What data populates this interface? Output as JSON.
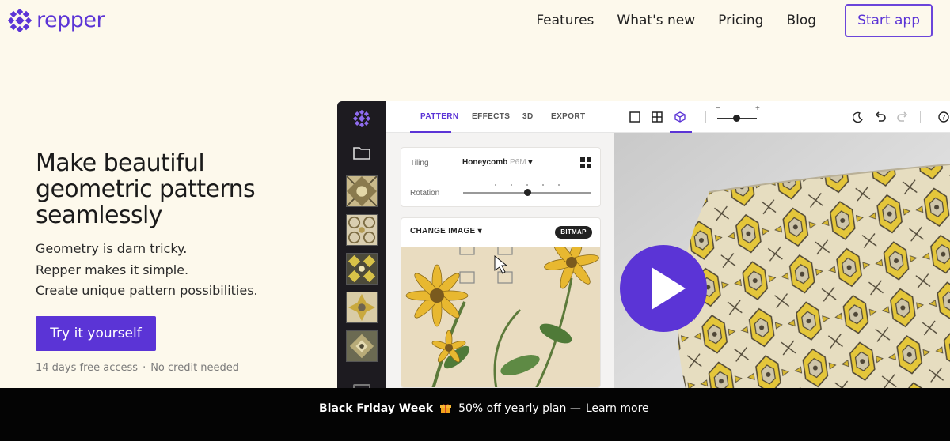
{
  "brand": {
    "name": "repper",
    "color": "#5b34d6"
  },
  "nav": {
    "links": [
      "Features",
      "What's new",
      "Pricing",
      "Blog"
    ],
    "cta": "Start app"
  },
  "hero": {
    "title": "Make beautiful geometric patterns seamlessly",
    "lines": [
      "Geometry is darn tricky.",
      "Repper makes it simple.",
      "Create unique pattern possibilities."
    ],
    "cta": "Try it yourself",
    "note_left": "14 days free access",
    "note_sep": "·",
    "note_right": "No credit needed"
  },
  "app": {
    "tabs": [
      "PATTERN",
      "EFFECTS",
      "3D",
      "EXPORT"
    ],
    "active_tab": "PATTERN",
    "tiling_label": "Tiling",
    "tiling_value": "Honeycomb",
    "tiling_sub": "P6M",
    "rotation_label": "Rotation",
    "change_image": "CHANGE IMAGE",
    "bitmap": "BITMAP",
    "view_mode": "3D",
    "icons": [
      "single-tile-icon",
      "grid-tile-icon",
      "cube-3d-icon",
      "zoom-slider",
      "dark-mode-icon",
      "undo-icon",
      "redo-icon",
      "help-icon"
    ]
  },
  "banner": {
    "title": "Black Friday Week",
    "offer": "50% off yearly plan —",
    "link": "Learn more"
  }
}
